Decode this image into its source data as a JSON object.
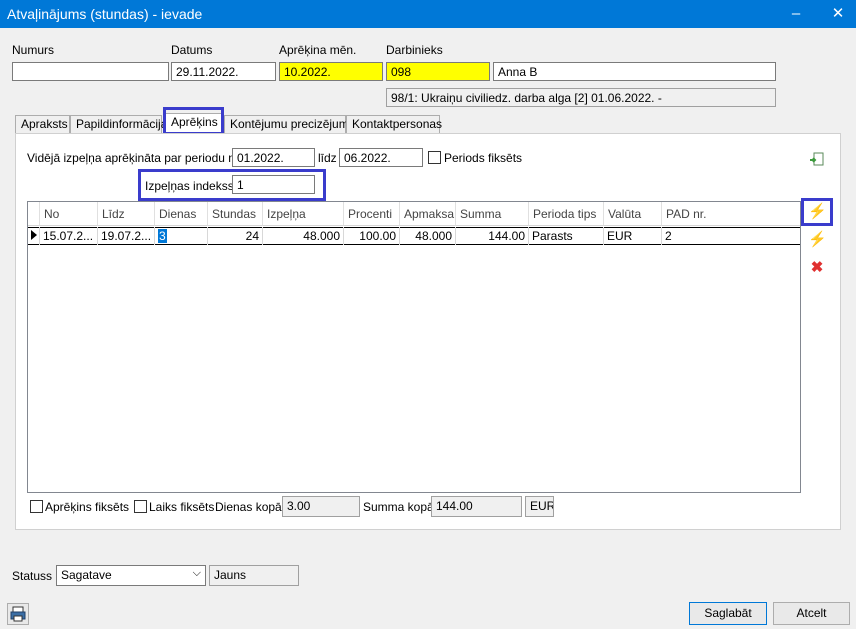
{
  "window": {
    "title": "Atvaļinājums (stundas) - ievade",
    "minimize": "–",
    "close": "✕"
  },
  "header": {
    "numurs_label": "Numurs",
    "numurs_value": "",
    "datums_label": "Datums",
    "datums_value": "29.11.2022.",
    "aprekina_men_label": "Aprēķina mēn.",
    "aprekina_men_value": "10.2022.",
    "darbinieks_label": "Darbinieks",
    "darbinieks_code": "098",
    "darbinieks_name": "Anna B",
    "info_line": "98/1: Ukraiņu civiliedz. darba alga [2] 01.06.2022. -"
  },
  "tabs": [
    "Apraksts",
    "Papildinformācija",
    "Aprēķins",
    "Kontējumu precizējumi",
    "Kontaktpersonas"
  ],
  "calc": {
    "period_label": "Vidējā izpeļņa aprēķināta par periodu no",
    "period_from": "01.2022.",
    "period_to_label": "līdz",
    "period_to": "06.2022.",
    "period_fixed_label": "Periods fiksēts",
    "index_label": "Izpeļņas indekss",
    "index_value": "1"
  },
  "grid": {
    "columns": [
      "No",
      "Līdz",
      "Dienas",
      "Stundas",
      "Izpeļņa",
      "Procenti",
      "Apmaksa",
      "Summa",
      "Perioda tips",
      "Valūta",
      "PAD nr."
    ],
    "row": [
      "15.07.2...",
      "19.07.2...",
      "3",
      "24",
      "48.000",
      "100.00",
      "48.000",
      "144.00",
      "Parasts",
      "EUR",
      "2"
    ]
  },
  "footer": {
    "calc_fixed_label": "Aprēķins fiksēts",
    "time_fixed_label": "Laiks fiksēts",
    "days_total_label": "Dienas kopā",
    "days_total_value": "3.00",
    "sum_total_label": "Summa kopā",
    "sum_total_value": "144.00",
    "currency": "EUR"
  },
  "status": {
    "label": "Statuss",
    "value": "Sagatave",
    "state": "Jauns"
  },
  "buttons": {
    "save": "Saglabāt",
    "cancel": "Atcelt"
  },
  "icons": {
    "refresh": "refresh-icon",
    "lightning": "lightning-icon",
    "delete": "delete-icon",
    "printer": "printer-icon"
  }
}
